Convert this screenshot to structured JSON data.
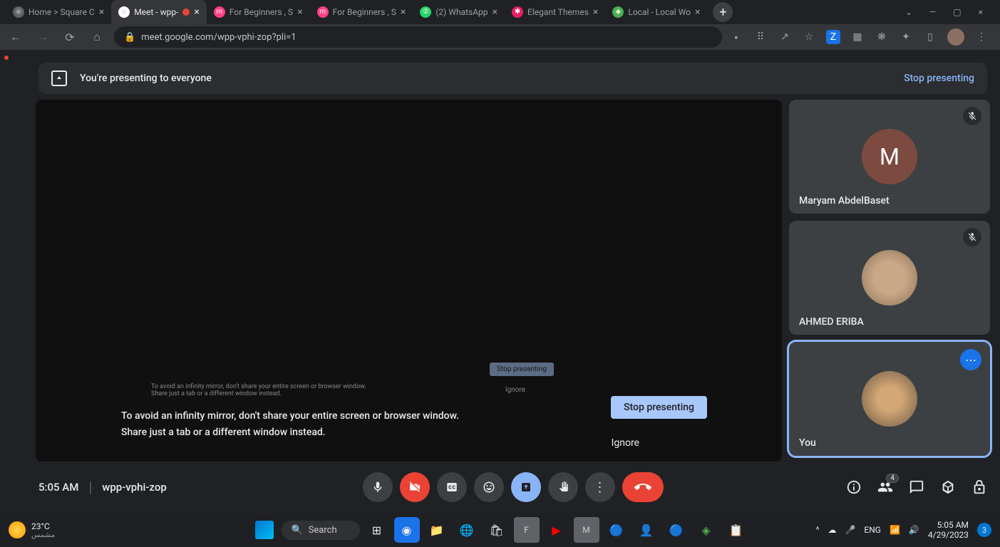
{
  "browser": {
    "tabs": [
      {
        "title": "Home > Square C",
        "active": false,
        "favicon_bg": "#5f6368"
      },
      {
        "title": "Meet - wpp-",
        "active": true,
        "favicon_bg": "#34a853",
        "recording": true
      },
      {
        "title": "For Beginners , S",
        "active": false,
        "favicon_bg": "#ff4081"
      },
      {
        "title": "For Beginners , S",
        "active": false,
        "favicon_bg": "#ff4081"
      },
      {
        "title": "(2) WhatsApp",
        "active": false,
        "favicon_bg": "#25d366"
      },
      {
        "title": "Elegant Themes",
        "active": false,
        "favicon_bg": "#e91e63"
      },
      {
        "title": "Local - Local Wo",
        "active": false,
        "favicon_bg": "#4caf50"
      }
    ],
    "url": "meet.google.com/wpp-vphi-zop?pli=1"
  },
  "banner": {
    "text": "You're presenting to everyone",
    "stop_link": "Stop presenting"
  },
  "mirror_msg": {
    "line1": "To avoid an infinity mirror, don't share your entire screen or browser window.",
    "line2": "Share just a tab or a different window instead."
  },
  "overlay": {
    "stop": "Stop presenting",
    "ignore": "Ignore"
  },
  "participants": [
    {
      "name": "Maryam AbdelBaset",
      "initial": "M",
      "muted": true,
      "type": "initial"
    },
    {
      "name": "AHMED ERIBA",
      "muted": true,
      "type": "photo"
    },
    {
      "name": "You",
      "active": true,
      "type": "photo",
      "more": true
    }
  ],
  "participant_count": "4",
  "bottom": {
    "time": "5:05 AM",
    "code": "wpp-vphi-zop"
  },
  "taskbar": {
    "temp": "23°C",
    "weather_label": "مشمس",
    "search": "Search",
    "lang": "ENG",
    "time": "5:05 AM",
    "date": "4/29/2023",
    "notif": "3"
  }
}
